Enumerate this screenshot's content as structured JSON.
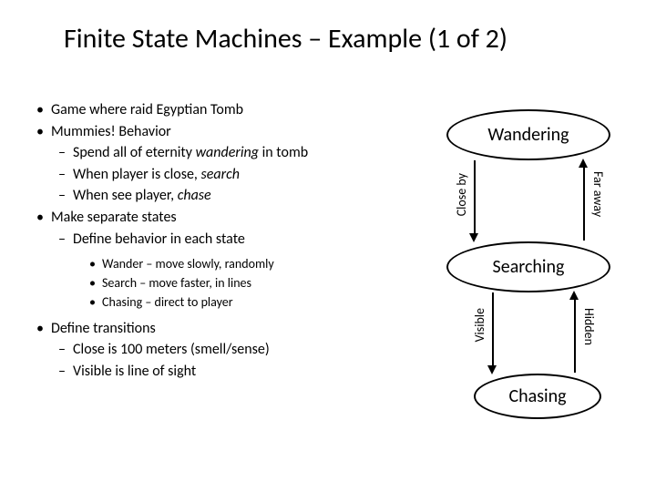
{
  "title": "Finite State Machines – Example (1 of 2)",
  "bullets": {
    "b0": "Game where raid Egyptian Tomb",
    "b1": "Mummies!  Behavior",
    "b1a": "Spend all of eternity wandering in tomb",
    "b1b": "When player is close, search",
    "b1c": "When see player, chase",
    "b2": "Make separate states",
    "b2a": "Define behavior in each state",
    "b2a1": "Wander – move slowly, randomly",
    "b2a2": "Search – move faster, in lines",
    "b2a3": "Chasing – direct to player",
    "b3": "Define transitions",
    "b3a": "Close is 100 meters (smell/sense)",
    "b3b": "Visible is line of sight"
  },
  "states": {
    "wandering": "Wandering",
    "searching": "Searching",
    "chasing": "Chasing"
  },
  "edges": {
    "closeby": "Close by",
    "faraway": "Far away",
    "visible": "Visible",
    "hidden": "Hidden"
  }
}
